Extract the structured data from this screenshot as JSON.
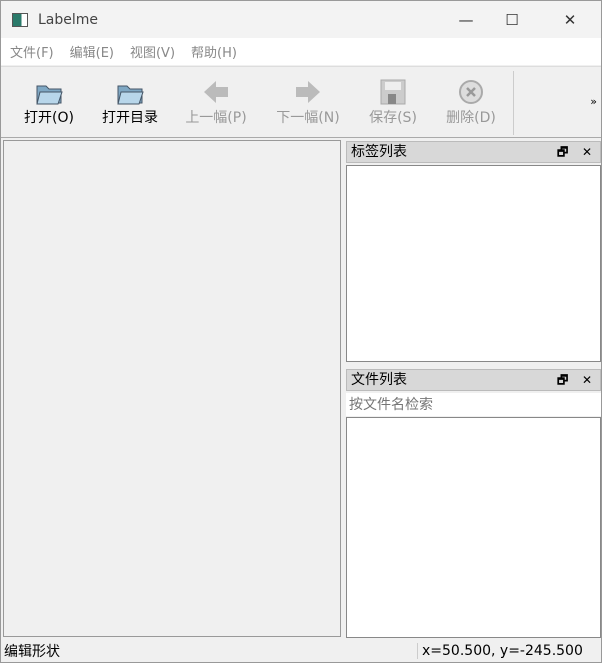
{
  "window": {
    "title": "Labelme",
    "minimize": "—",
    "maximize": "☐",
    "close": "✕"
  },
  "menu": [
    "文件(F)",
    "编辑(E)",
    "视图(V)",
    "帮助(H)"
  ],
  "toolbar": [
    {
      "label": "打开(O)",
      "icon": "folder-open-icon",
      "enabled": true
    },
    {
      "label": "打开目录",
      "icon": "folder-open-icon",
      "enabled": true
    },
    {
      "label": "上一幅(P)",
      "icon": "arrow-left-icon",
      "enabled": false
    },
    {
      "label": "下一幅(N)",
      "icon": "arrow-right-icon",
      "enabled": false
    },
    {
      "label": "保存(S)",
      "icon": "floppy-disk-icon",
      "enabled": false
    },
    {
      "label": "删除(D)",
      "icon": "delete-circle-icon",
      "enabled": false
    }
  ],
  "toolbar_more": "»",
  "label_dock": {
    "title": "标签列表",
    "float": "🗗",
    "close": "✕"
  },
  "file_dock": {
    "title": "文件列表",
    "float": "🗗",
    "close": "✕",
    "search_placeholder": "按文件名检索"
  },
  "status": {
    "mode": "编辑形状",
    "coords": "x=50.500, y=-245.500"
  }
}
